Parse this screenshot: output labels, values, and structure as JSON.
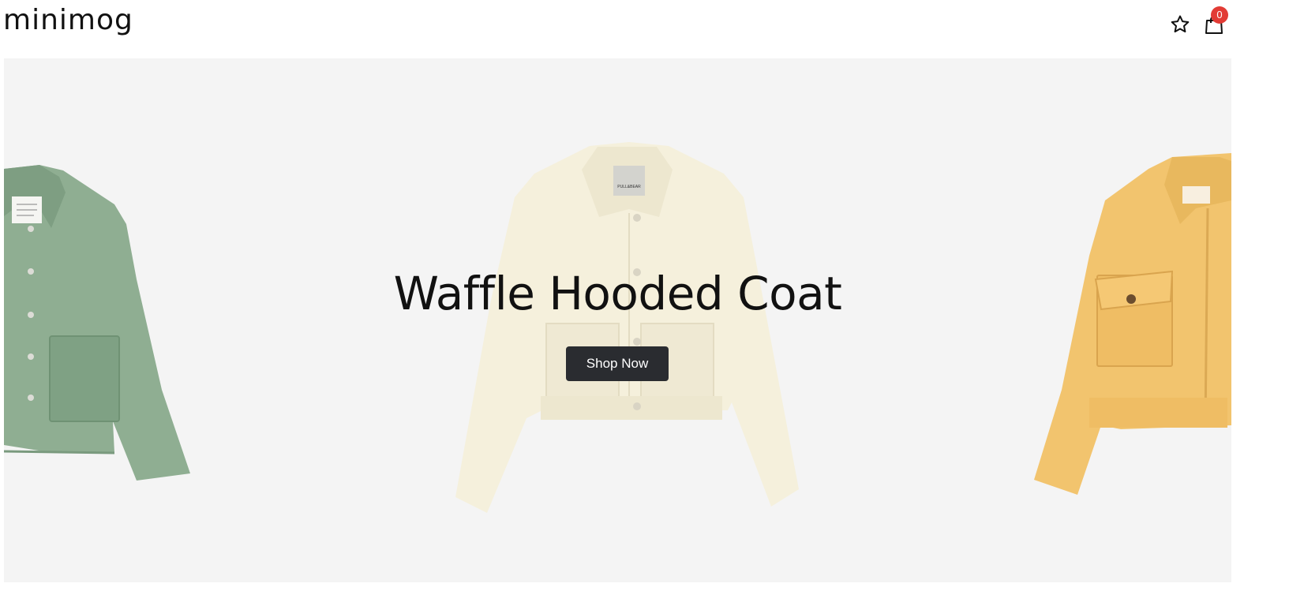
{
  "header": {
    "logo": "minimog",
    "wishlist_icon": "star-icon",
    "cart_icon": "shopping-bag-icon",
    "cart_count": "0",
    "badge_color": "#e23b35"
  },
  "hero": {
    "title": "Waffle Hooded Coat",
    "button_label": "Shop Now",
    "background": "#f4f4f4",
    "jacket_colors": {
      "left": "#8fae92",
      "center": "#f5f0dc",
      "right": "#f2c46e"
    },
    "tag_text": "PULL&BEAR"
  }
}
